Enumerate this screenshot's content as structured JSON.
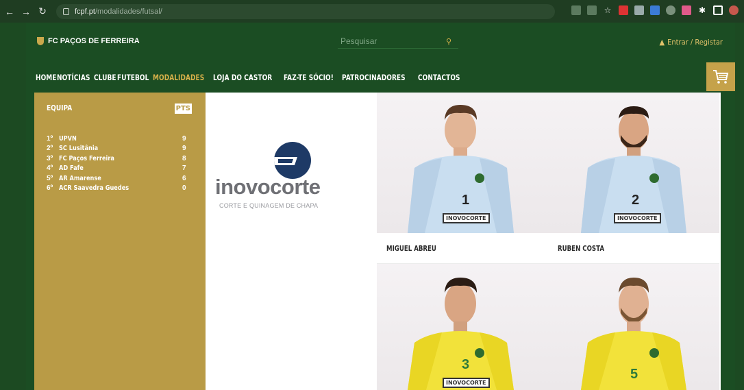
{
  "browser": {
    "url_host": "fcpf.pt",
    "url_path": "/modalidades/futsal/"
  },
  "site": {
    "brand": "FC PAÇOS DE FERREIRA",
    "search_placeholder": "Pesquisar",
    "login": "Entrar / Registar",
    "menu": [
      "HOME",
      "NOTÍCIAS",
      "CLUBE",
      "FUTEBOL",
      "MODALIDADES",
      "LOJA DO CASTOR",
      "FAZ-TE SÓCIO!",
      "PATROCINADORES",
      "CONTACTOS"
    ],
    "menu_active": "MODALIDADES",
    "colors": {
      "green": "#1b4d23",
      "gold": "#b99b46",
      "accent": "#d6b04a"
    }
  },
  "standings": {
    "col_team": "EQUIPA",
    "col_pts": "PTS",
    "rows": [
      {
        "pos": "1º",
        "team": "UPVN",
        "pts": "9"
      },
      {
        "pos": "2º",
        "team": "SC Lusitânia",
        "pts": "9"
      },
      {
        "pos": "3º",
        "team": "FC Paços Ferreira",
        "pts": "8"
      },
      {
        "pos": "4º",
        "team": "AD Fafe",
        "pts": "7"
      },
      {
        "pos": "5º",
        "team": "AR Amarense",
        "pts": "6"
      },
      {
        "pos": "6º",
        "team": "ACR Saavedra Guedes",
        "pts": "0"
      }
    ]
  },
  "sponsor": {
    "name": "inovocorte",
    "tagline": "CORTE E QUINAGEM DE CHAPA"
  },
  "players": [
    {
      "name": "MIGUEL ABREU",
      "number": "1",
      "kit": "blue"
    },
    {
      "name": "RUBEN COSTA",
      "number": "2",
      "kit": "blue"
    },
    {
      "name": "",
      "number": "3",
      "kit": "yellow"
    },
    {
      "name": "",
      "number": "5",
      "kit": "yellow"
    }
  ],
  "shirt_sponsor": "INOVOCORTE"
}
